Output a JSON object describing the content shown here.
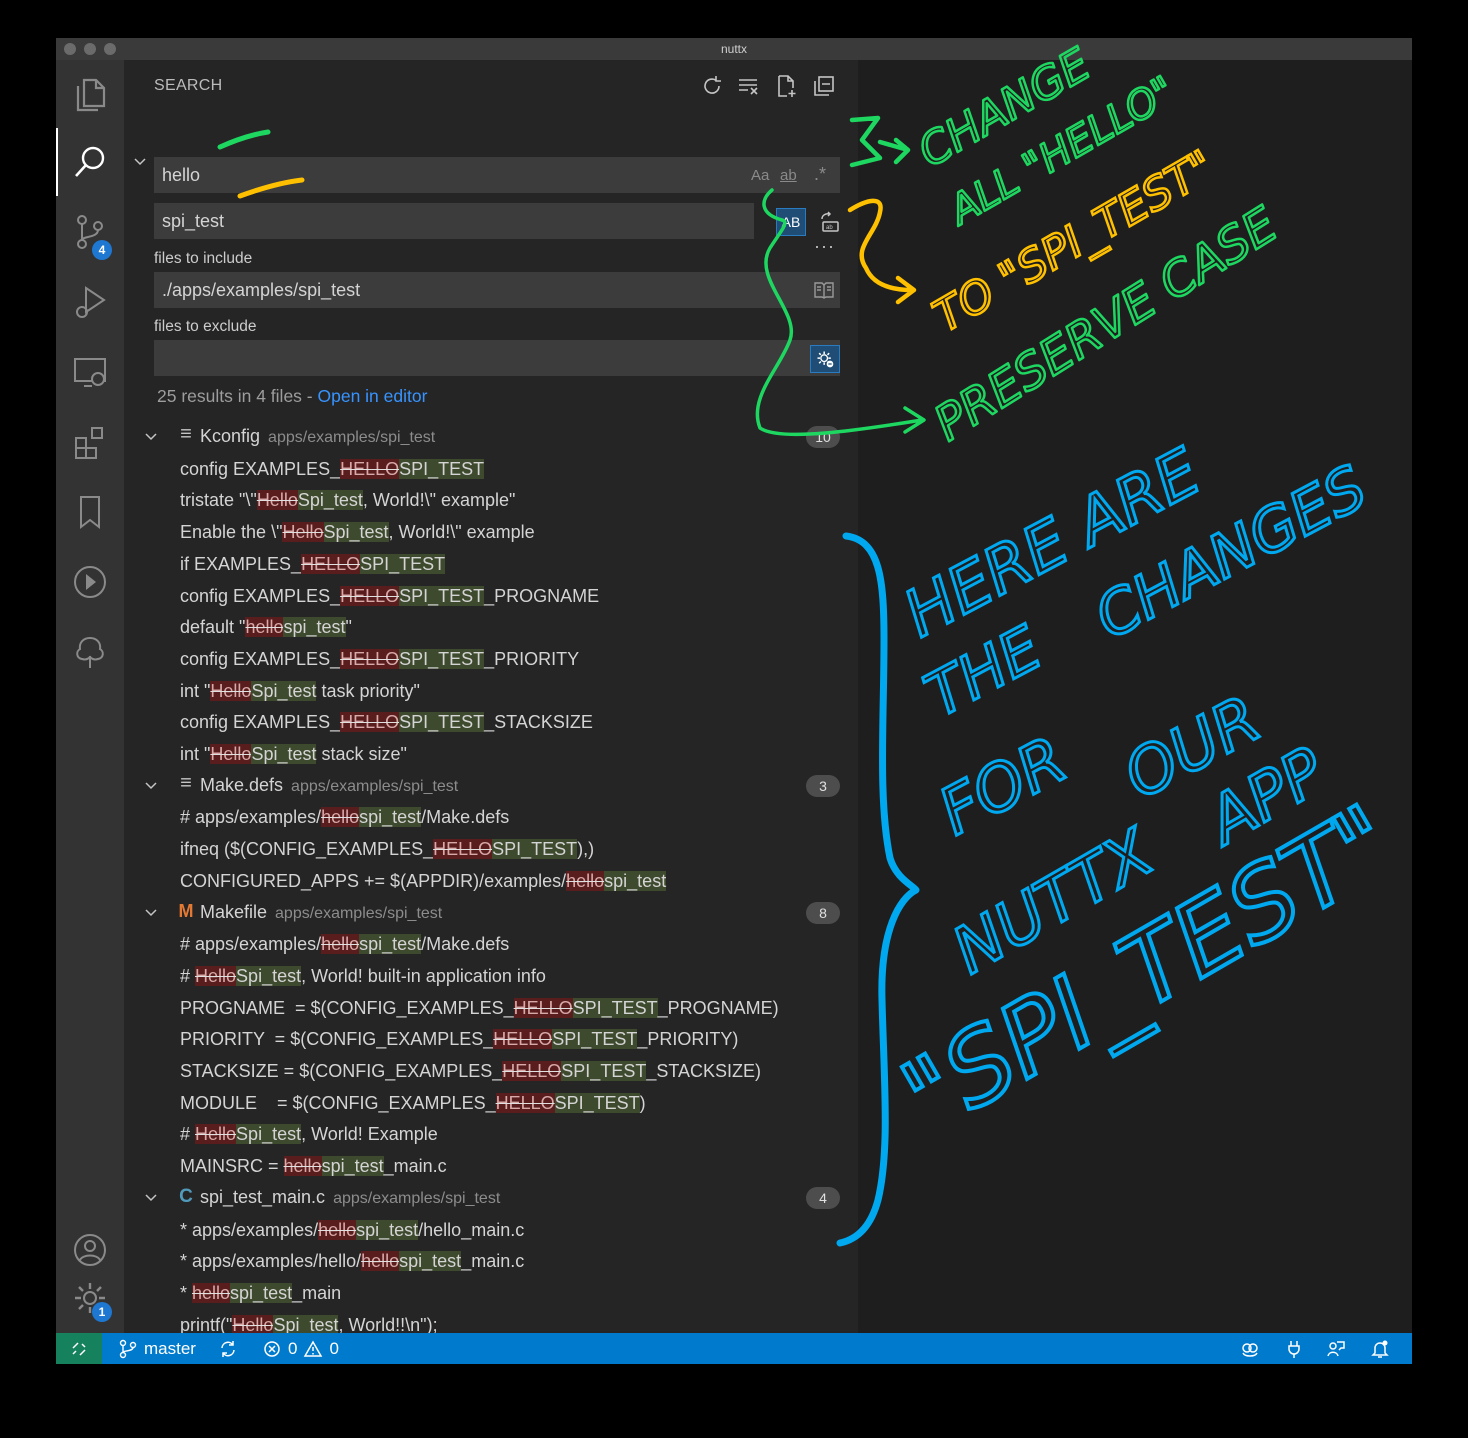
{
  "window": {
    "title": "nuttx"
  },
  "activity": {
    "scm_badge": "4",
    "settings_badge": "1"
  },
  "search": {
    "panel_title": "SEARCH",
    "query": "hello",
    "replace": "spi_test",
    "opt_case": "Aa",
    "opt_word": "ab",
    "opt_regex": ".*",
    "preserve_case": "AB",
    "more": "···",
    "include_label": "files to include",
    "include_value": "./apps/examples/spi_test",
    "exclude_label": "files to exclude",
    "exclude_value": "",
    "summary": "25 results in 4 files -",
    "open_in_editor": "Open in editor"
  },
  "files": [
    {
      "name": "Kconfig",
      "path": "apps/examples/spi_test",
      "count": "10",
      "matches": [
        [
          [
            "config EXAMPLES_",
            ""
          ],
          [
            "HELLO",
            "del"
          ],
          [
            "SPI_TEST",
            "ins"
          ]
        ],
        [
          [
            "tristate \"\\\"",
            ""
          ],
          [
            "Hello",
            "del"
          ],
          [
            "Spi_test",
            "ins"
          ],
          [
            ", World!\\\" example\"",
            ""
          ]
        ],
        [
          [
            "Enable the \\\"",
            ""
          ],
          [
            "Hello",
            "del"
          ],
          [
            "Spi_test",
            "ins"
          ],
          [
            ", World!\\\" example",
            ""
          ]
        ],
        [
          [
            "if EXAMPLES_",
            ""
          ],
          [
            "HELLO",
            "del"
          ],
          [
            "SPI_TEST",
            "ins"
          ]
        ],
        [
          [
            "config EXAMPLES_",
            ""
          ],
          [
            "HELLO",
            "del"
          ],
          [
            "SPI_TEST",
            "ins"
          ],
          [
            "_PROGNAME",
            ""
          ]
        ],
        [
          [
            "default \"",
            ""
          ],
          [
            "hello",
            "del"
          ],
          [
            "spi_test",
            "ins"
          ],
          [
            "\"",
            ""
          ]
        ],
        [
          [
            "config EXAMPLES_",
            ""
          ],
          [
            "HELLO",
            "del"
          ],
          [
            "SPI_TEST",
            "ins"
          ],
          [
            "_PRIORITY",
            ""
          ]
        ],
        [
          [
            "int \"",
            ""
          ],
          [
            "Hello",
            "del"
          ],
          [
            "Spi_test",
            "ins"
          ],
          [
            " task priority\"",
            ""
          ]
        ],
        [
          [
            "config EXAMPLES_",
            ""
          ],
          [
            "HELLO",
            "del"
          ],
          [
            "SPI_TEST",
            "ins"
          ],
          [
            "_STACKSIZE",
            ""
          ]
        ],
        [
          [
            "int \"",
            ""
          ],
          [
            "Hello",
            "del"
          ],
          [
            "Spi_test",
            "ins"
          ],
          [
            " stack size\"",
            ""
          ]
        ]
      ]
    },
    {
      "name": "Make.defs",
      "path": "apps/examples/spi_test",
      "count": "3",
      "matches": [
        [
          [
            "# apps/examples/",
            ""
          ],
          [
            "hello",
            "del"
          ],
          [
            "spi_test",
            "ins"
          ],
          [
            "/Make.defs",
            ""
          ]
        ],
        [
          [
            "ifneq ($(CONFIG_EXAMPLES_",
            ""
          ],
          [
            "HELLO",
            "del"
          ],
          [
            "SPI_TEST",
            "ins"
          ],
          [
            "),)",
            ""
          ]
        ],
        [
          [
            "CONFIGURED_APPS += $(APPDIR)/examples/",
            ""
          ],
          [
            "hello",
            "del"
          ],
          [
            "spi_test",
            "ins"
          ]
        ]
      ]
    },
    {
      "name": "Makefile",
      "path": "apps/examples/spi_test",
      "count": "8",
      "matches": [
        [
          [
            "# apps/examples/",
            ""
          ],
          [
            "hello",
            "del"
          ],
          [
            "spi_test",
            "ins"
          ],
          [
            "/Make.defs",
            ""
          ]
        ],
        [
          [
            "# ",
            ""
          ],
          [
            "Hello",
            "del"
          ],
          [
            "Spi_test",
            "ins"
          ],
          [
            ", World! built-in application info",
            ""
          ]
        ],
        [
          [
            "PROGNAME  = $(CONFIG_EXAMPLES_",
            ""
          ],
          [
            "HELLO",
            "del"
          ],
          [
            "SPI_TEST",
            "ins"
          ],
          [
            "_PROGNAME)",
            ""
          ]
        ],
        [
          [
            "PRIORITY  = $(CONFIG_EXAMPLES_",
            ""
          ],
          [
            "HELLO",
            "del"
          ],
          [
            "SPI_TEST",
            "ins"
          ],
          [
            "_PRIORITY)",
            ""
          ]
        ],
        [
          [
            "STACKSIZE = $(CONFIG_EXAMPLES_",
            ""
          ],
          [
            "HELLO",
            "del"
          ],
          [
            "SPI_TEST",
            "ins"
          ],
          [
            "_STACKSIZE)",
            ""
          ]
        ],
        [
          [
            "MODULE    = $(CONFIG_EXAMPLES_",
            ""
          ],
          [
            "HELLO",
            "del"
          ],
          [
            "SPI_TEST",
            "ins"
          ],
          [
            ")",
            ""
          ]
        ],
        [
          [
            "# ",
            ""
          ],
          [
            "Hello",
            "del"
          ],
          [
            "Spi_test",
            "ins"
          ],
          [
            ", World! Example",
            ""
          ]
        ],
        [
          [
            "MAINSRC = ",
            ""
          ],
          [
            "hello",
            "del"
          ],
          [
            "spi_test",
            "ins"
          ],
          [
            "_main.c",
            ""
          ]
        ]
      ]
    },
    {
      "name": "spi_test_main.c",
      "path": "apps/examples/spi_test",
      "count": "4",
      "matches": [
        [
          [
            "* apps/examples/",
            ""
          ],
          [
            "hello",
            "del"
          ],
          [
            "spi_test",
            "ins"
          ],
          [
            "/hello_main.c",
            ""
          ]
        ],
        [
          [
            "* apps/examples/hello/",
            ""
          ],
          [
            "hello",
            "del"
          ],
          [
            "spi_test",
            "ins"
          ],
          [
            "_main.c",
            ""
          ]
        ],
        [
          [
            "* ",
            ""
          ],
          [
            "hello",
            "del"
          ],
          [
            "spi_test",
            "ins"
          ],
          [
            "_main",
            ""
          ]
        ],
        [
          [
            "printf(\"",
            ""
          ],
          [
            "Hello",
            "del"
          ],
          [
            "Spi_test",
            "ins"
          ],
          [
            ", World!!\\n\");",
            ""
          ]
        ]
      ]
    }
  ],
  "file_icons": [
    "lines-file-icon",
    "lines-file-icon",
    "makefile-m-icon",
    "c-language-icon"
  ],
  "file_icon_colors": [
    "#c5c5c5",
    "#c5c5c5",
    "#e37933",
    "#519aba"
  ],
  "status": {
    "branch": "master",
    "errors": "0",
    "warnings": "0"
  },
  "colors": {
    "accent": "#007acc",
    "remote": "#16825d",
    "deleted_bg": "#5a1d1d",
    "inserted_bg": "#3e4a2e",
    "link": "#3794ff",
    "annotation_green": "#1ed760",
    "annotation_yellow": "#ffc000",
    "annotation_blue": "#00a8f0"
  }
}
